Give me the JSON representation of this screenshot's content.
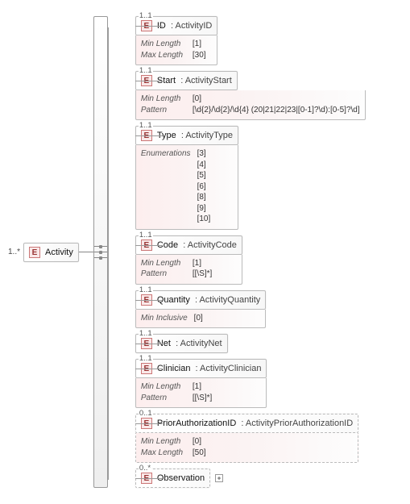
{
  "root": {
    "cardinality": "1..*",
    "e_badge": "E",
    "name": "Activity"
  },
  "children": [
    {
      "cardinality": "1..1",
      "name": "ID",
      "type": ": ActivityID",
      "optional": false,
      "details": [
        {
          "key": "Min Length",
          "val": "[1]"
        },
        {
          "key": "Max Length",
          "val": "[30]"
        }
      ]
    },
    {
      "cardinality": "1..1",
      "name": "Start",
      "type": ": ActivityStart",
      "optional": false,
      "details": [
        {
          "key": "Min Length",
          "val": "[0]"
        },
        {
          "key": "Pattern",
          "val": "[\\d{2}/\\d{2}/\\d{4} (20|21|22|23|[0-1]?\\d):[0-5]?\\d]"
        }
      ]
    },
    {
      "cardinality": "1..1",
      "name": "Type",
      "type": ": ActivityType",
      "optional": false,
      "details": [
        {
          "key": "Enumerations",
          "val": "[3]\n[4]\n[5]\n[6]\n[8]\n[9]\n[10]"
        }
      ]
    },
    {
      "cardinality": "1..1",
      "name": "Code",
      "type": ": ActivityCode",
      "optional": false,
      "details": [
        {
          "key": "Min Length",
          "val": "[1]"
        },
        {
          "key": "Pattern",
          "val": "[[\\S]*]"
        }
      ]
    },
    {
      "cardinality": "1..1",
      "name": "Quantity",
      "type": ": ActivityQuantity",
      "optional": false,
      "details": [
        {
          "key": "Min Inclusive",
          "val": "[0]"
        }
      ]
    },
    {
      "cardinality": "1..1",
      "name": "Net",
      "type": ": ActivityNet",
      "optional": false,
      "details": []
    },
    {
      "cardinality": "1..1",
      "name": "Clinician",
      "type": ": ActivityClinician",
      "optional": false,
      "details": [
        {
          "key": "Min Length",
          "val": "[1]"
        },
        {
          "key": "Pattern",
          "val": "[[\\S]*]"
        }
      ]
    },
    {
      "cardinality": "0..1",
      "name": "PriorAuthorizationID",
      "type": ": ActivityPriorAuthorizationID",
      "optional": true,
      "details": [
        {
          "key": "Min Length",
          "val": "[0]"
        },
        {
          "key": "Max Length",
          "val": "[50]"
        }
      ]
    },
    {
      "cardinality": "0..*",
      "name": "Observation",
      "type": "",
      "optional": true,
      "details": [],
      "expandable": true
    }
  ],
  "e_badge": "E"
}
